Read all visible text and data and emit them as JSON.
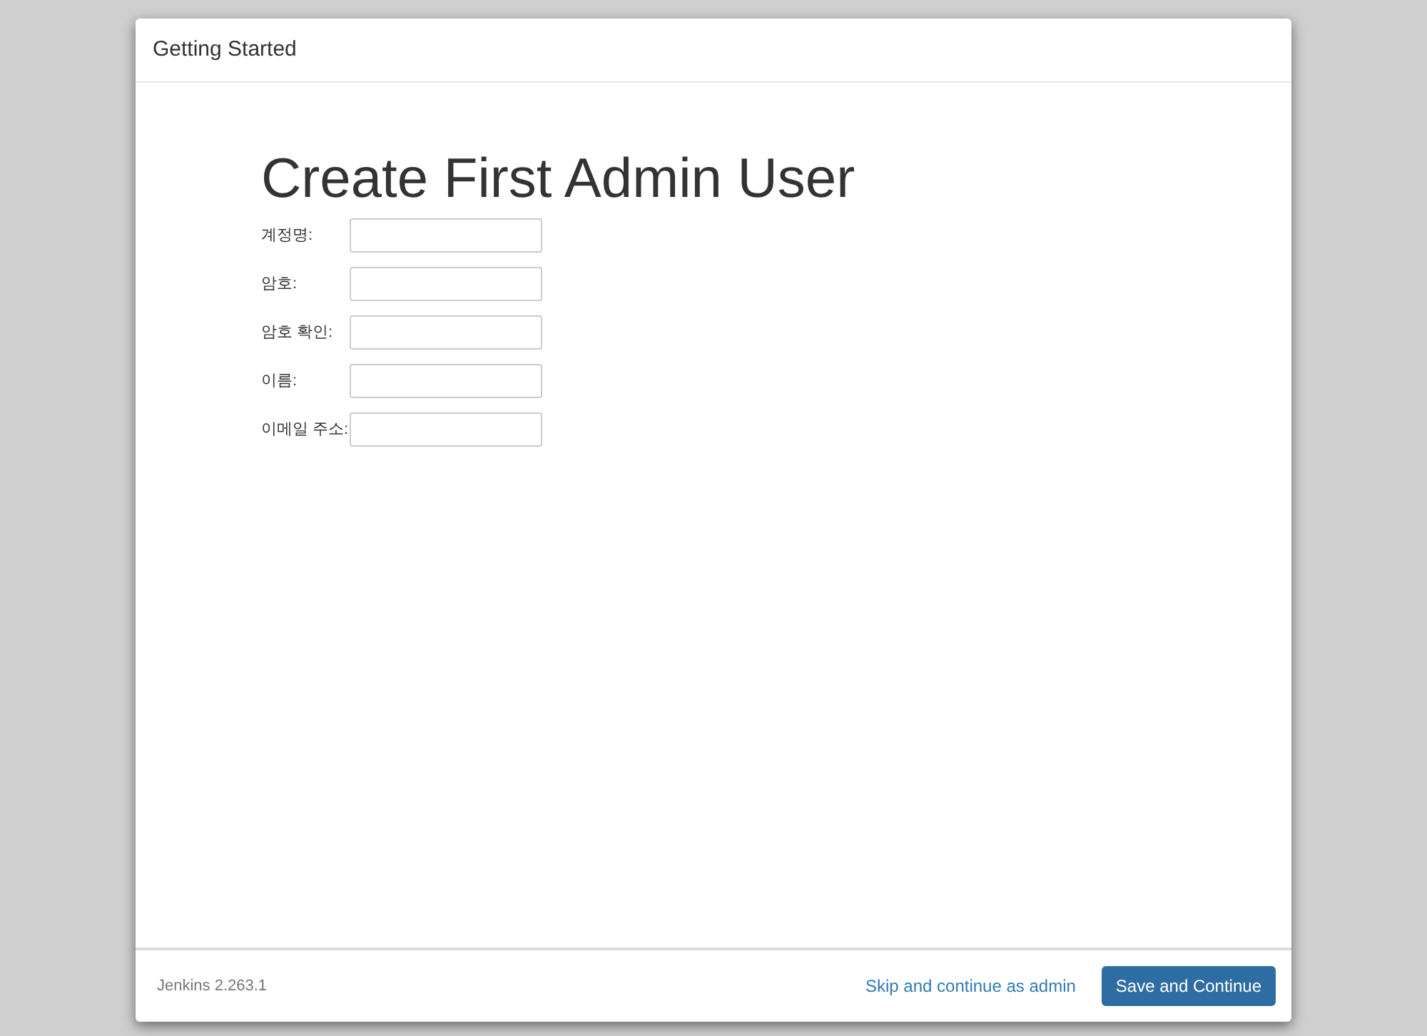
{
  "dialog": {
    "title": "Getting Started"
  },
  "heading": "Create First Admin User",
  "fields": [
    {
      "label": "계정명:"
    },
    {
      "label": "암호:"
    },
    {
      "label": "암호 확인:"
    },
    {
      "label": "이름:"
    },
    {
      "label": "이메일 주소:"
    }
  ],
  "footer": {
    "version": "Jenkins 2.263.1",
    "skip_link": "Skip and continue as admin",
    "save_button": "Save and Continue"
  }
}
